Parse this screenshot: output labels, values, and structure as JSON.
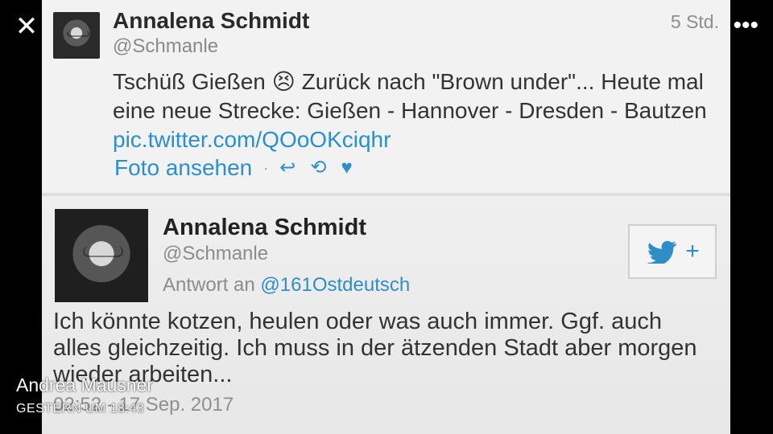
{
  "overlay": {
    "close_icon": "close-icon",
    "more_icon": "more-icon",
    "author": "Andrea Mausner",
    "posted": "GESTERN UM 18:43"
  },
  "tweet1": {
    "name": "Annalena Schmidt",
    "handle": "@Schmanle",
    "time": "5 Std.",
    "text_prefix": "Tschüß Gießen",
    "emoji": "😣",
    "text_middle": " Zurück nach \"Brown under\"... Heute mal eine neue Strecke: Gießen - Hannover - Dresden - Bautzen ",
    "link": "pic.twitter.com/QOoOKciqhr",
    "action_link": "Foto ansehen",
    "reply_icon": "reply-icon",
    "retweet_icon": "retweet-icon",
    "like_icon": "heart-icon"
  },
  "tweet2": {
    "name": "Annalena Schmidt",
    "handle": "@Schmanle",
    "reply_prefix": "Antwort an",
    "reply_handle": "@161Ostdeutsch",
    "text": "Ich könnte kotzen, heulen oder was auch immer. Ggf. auch alles gleichzeitig. Ich muss in der ätzenden Stadt aber morgen wieder arbeiten...",
    "timestamp": "02:52 - 17 Sep. 2017",
    "follow_plus": "+"
  },
  "colors": {
    "link": "#2b8fcb",
    "text": "#333333",
    "muted": "#8d8d8d"
  }
}
